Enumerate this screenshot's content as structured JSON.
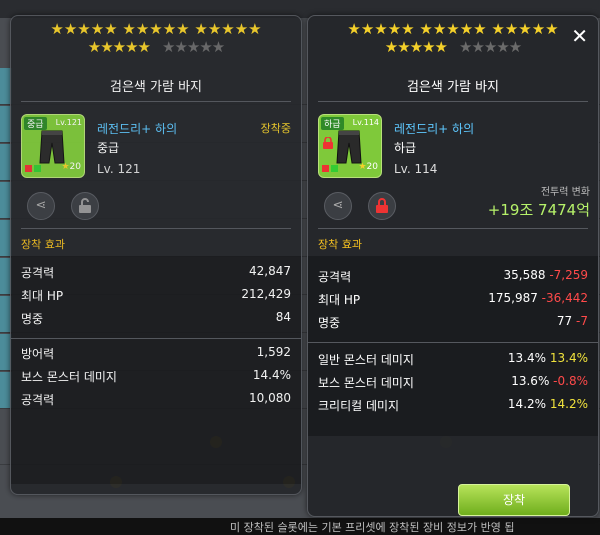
{
  "background": {
    "bottom_text": "미 장착된 슬롯에는 기본 프리셋에 장착된 장비 정보가 반영 됩"
  },
  "left_panel": {
    "stars_row1": "★★★★★  ★★★★★  ★★★★★",
    "stars_row2_on": "★★★★★",
    "stars_row2_off": "★★★★★",
    "item_name": "검은색 가람 바지",
    "icon": {
      "grade_tag": "중급",
      "level_tag": "Lv.121",
      "star_count": "20",
      "icon_name": "pants-icon"
    },
    "type": "레전드리+ 하의",
    "grade": "중급",
    "level": "Lv. 121",
    "status": "장착중",
    "buttons": {
      "share_icon": "share-icon",
      "lock_icon": "unlock-icon"
    },
    "section_title": "장착 효과",
    "stats_group1": [
      {
        "name": "공격력",
        "value": "42,847"
      },
      {
        "name": "최대 HP",
        "value": "212,429"
      },
      {
        "name": "명중",
        "value": "84"
      }
    ],
    "stats_group2": [
      {
        "name": "방어력",
        "value": "1,592"
      },
      {
        "name": "보스 몬스터 데미지",
        "value": "14.4%"
      },
      {
        "name": "공격력",
        "value": "10,080"
      }
    ]
  },
  "right_panel": {
    "stars_row1": "★★★★★  ★★★★★  ★★★★★",
    "stars_row2_on": "★★★★★",
    "stars_row2_off": "★★★★★",
    "close_label": "✕",
    "item_name": "검은색 가람 바지",
    "icon": {
      "grade_tag": "하급",
      "level_tag": "Lv.114",
      "star_count": "20",
      "icon_name": "pants-icon"
    },
    "type": "레전드리+ 하의",
    "grade": "하급",
    "level": "Lv. 114",
    "power_label": "전투력 변화",
    "power_value": "+19조 7474억",
    "buttons": {
      "share_icon": "share-icon",
      "lock_icon": "lock-icon"
    },
    "section_title": "장착 효과",
    "stats_group1": [
      {
        "name": "공격력",
        "value": "35,588",
        "delta": "-7,259",
        "delta_type": "neg"
      },
      {
        "name": "최대 HP",
        "value": "175,987",
        "delta": "-36,442",
        "delta_type": "neg"
      },
      {
        "name": "명중",
        "value": "77",
        "delta": "-7",
        "delta_type": "neg"
      }
    ],
    "stats_group2": [
      {
        "name": "일반 몬스터 데미지",
        "value": "13.4%",
        "delta": "13.4%",
        "delta_type": "pos"
      },
      {
        "name": "보스 몬스터 데미지",
        "value": "13.6%",
        "delta": "-0.8%",
        "delta_type": "neg"
      },
      {
        "name": "크리티컬 데미지",
        "value": "14.2%",
        "delta": "14.2%",
        "delta_type": "pos"
      }
    ],
    "equip_button": "장착"
  },
  "colors": {
    "accent_green": "#7fc93a",
    "star_gold": "#f4d02a",
    "negative": "#ff4a4a",
    "positive": "#f0e23c",
    "section_title": "#f4c020"
  }
}
